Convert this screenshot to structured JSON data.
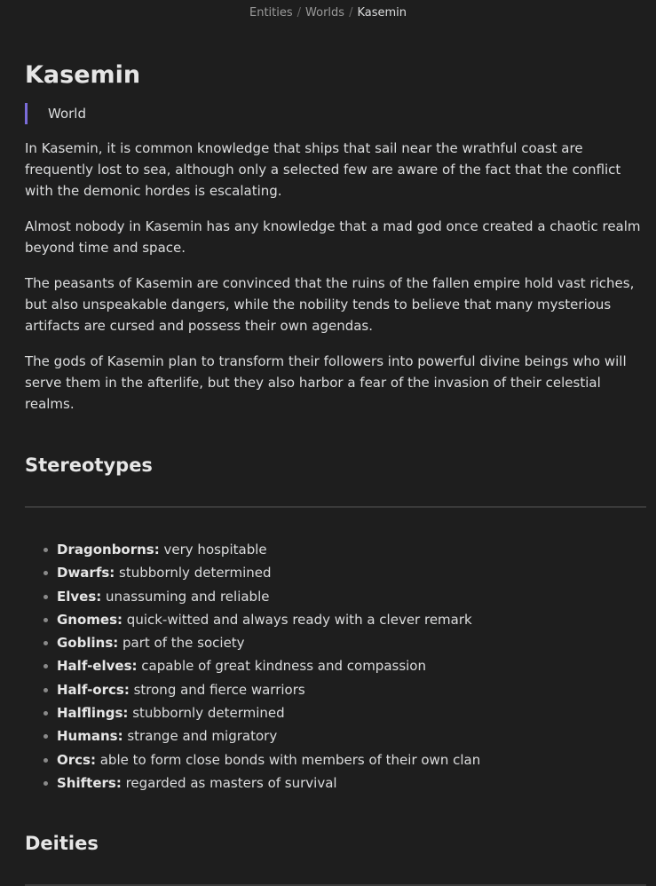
{
  "breadcrumb": {
    "items": [
      "Entities",
      "Worlds"
    ],
    "separator": "/",
    "current": "Kasemin"
  },
  "page": {
    "title": "Kasemin",
    "subtitle": "World",
    "accent_color": "#7b6cd9",
    "paragraphs": [
      "In Kasemin, it is common knowledge that ships that sail near the wrathful coast are frequently lost to sea, although only a selected few are aware of the fact that the conflict with the demonic hordes is escalating.",
      "Almost nobody in Kasemin has any knowledge that a mad god once created a chaotic realm beyond time and space.",
      "The peasants of Kasemin are convinced that the ruins of the fallen empire hold vast riches, but also unspeakable dangers, while the nobility tends to believe that many mysterious artifacts are cursed and possess their own agendas.",
      "The gods of Kasemin plan to transform their followers into powerful divine beings who will serve them in the afterlife, but they also harbor a fear of the invasion of their celestial realms."
    ]
  },
  "stereotypes": {
    "heading": "Stereotypes",
    "items": [
      {
        "race": "Dragonborns:",
        "desc": " very hospitable"
      },
      {
        "race": "Dwarfs:",
        "desc": " stubbornly determined"
      },
      {
        "race": "Elves:",
        "desc": " unassuming and reliable"
      },
      {
        "race": "Gnomes:",
        "desc": " quick-witted and always ready with a clever remark"
      },
      {
        "race": "Goblins:",
        "desc": " part of the society"
      },
      {
        "race": "Half-elves:",
        "desc": " capable of great kindness and compassion"
      },
      {
        "race": "Half-orcs:",
        "desc": " strong and fierce warriors"
      },
      {
        "race": "Halflings:",
        "desc": " stubbornly determined"
      },
      {
        "race": "Humans:",
        "desc": " strange and migratory"
      },
      {
        "race": "Orcs:",
        "desc": " able to form close bonds with members of their own clan"
      },
      {
        "race": "Shifters:",
        "desc": " regarded as masters of survival"
      }
    ]
  },
  "deities": {
    "heading": "Deities"
  }
}
